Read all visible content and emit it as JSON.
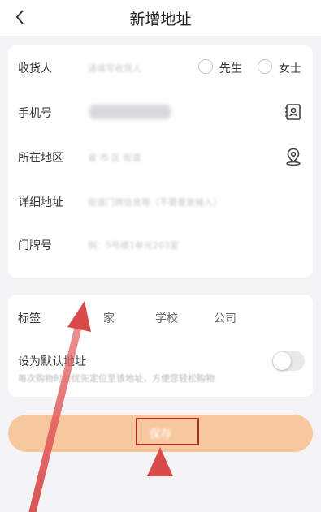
{
  "header": {
    "title": "新增地址",
    "back_icon": "chevron-left-icon"
  },
  "form": {
    "receiver": {
      "label": "收货人",
      "placeholder": "请填写收货人",
      "options": [
        {
          "label": "先生",
          "selected": false
        },
        {
          "label": "女士",
          "selected": false
        }
      ]
    },
    "phone": {
      "label": "手机号",
      "value_obscured": true,
      "icon": "contact-book-icon"
    },
    "region": {
      "label": "所在地区",
      "placeholder": "省  市  区  街道",
      "icon": "location-pin-icon"
    },
    "address": {
      "label": "详细地址",
      "placeholder": "街道门牌信息等（不要重复输入）"
    },
    "door": {
      "label": "门牌号",
      "placeholder": "例：5号楼1单元203室"
    }
  },
  "tags": {
    "label": "标签",
    "items": [
      "家",
      "学校",
      "公司"
    ]
  },
  "default_setting": {
    "title": "设为默认地址",
    "subtitle": "每次购物时会优先定位至该地址，方便您轻松购物",
    "enabled": false
  },
  "save_button": {
    "label": "保存"
  },
  "annotations": {
    "highlight_color": "#b12a1f"
  },
  "colors": {
    "button_bg": "#f7c79d",
    "page_bg": "#f4f4f6"
  }
}
